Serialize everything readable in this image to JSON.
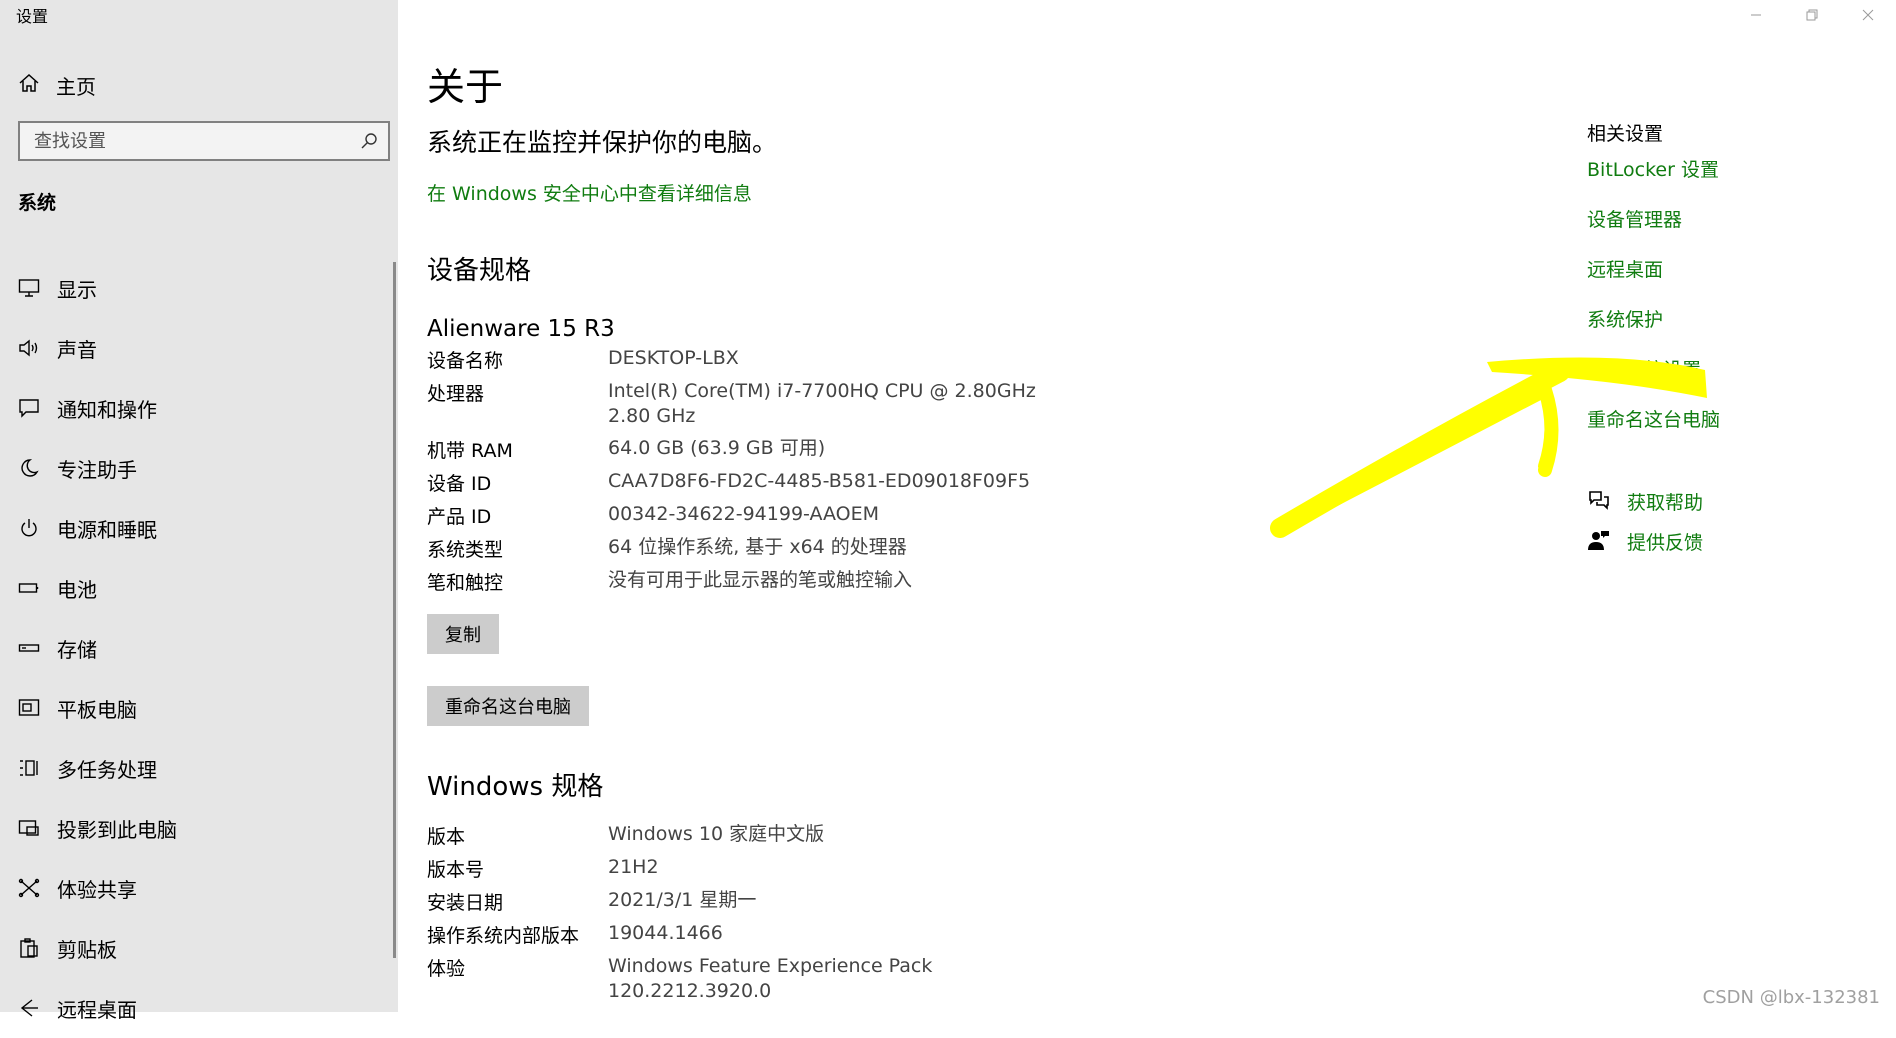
{
  "window": {
    "title": "设置",
    "controls": [
      "minimize-icon",
      "restore-icon",
      "close-icon"
    ]
  },
  "sidebar": {
    "home_label": "主页",
    "search_placeholder": "查找设置",
    "section_title": "系统",
    "items": [
      {
        "label": "显示",
        "icon": "display-icon"
      },
      {
        "label": "声音",
        "icon": "speaker-icon"
      },
      {
        "label": "通知和操作",
        "icon": "notification-icon"
      },
      {
        "label": "专注助手",
        "icon": "moon-icon"
      },
      {
        "label": "电源和睡眠",
        "icon": "power-icon"
      },
      {
        "label": "电池",
        "icon": "battery-icon"
      },
      {
        "label": "存储",
        "icon": "storage-icon"
      },
      {
        "label": "平板电脑",
        "icon": "tablet-icon"
      },
      {
        "label": "多任务处理",
        "icon": "multitask-icon"
      },
      {
        "label": "投影到此电脑",
        "icon": "project-icon"
      },
      {
        "label": "体验共享",
        "icon": "share-icon"
      },
      {
        "label": "剪贴板",
        "icon": "clipboard-icon"
      },
      {
        "label": "远程桌面",
        "icon": "remote-desktop-icon"
      }
    ]
  },
  "main": {
    "title": "关于",
    "protection_text": "系统正在监控并保护你的电脑。",
    "security_link": "在 Windows 安全中心中查看详细信息",
    "device_specs": {
      "heading": "设备规格",
      "device_model": "Alienware 15 R3",
      "rows": [
        {
          "key": "设备名称",
          "value": "DESKTOP-LBX"
        },
        {
          "key": "处理器",
          "value": "Intel(R) Core(TM) i7-7700HQ CPU @ 2.80GHz",
          "value2": "2.80 GHz"
        },
        {
          "key": "机带 RAM",
          "value": "64.0 GB (63.9 GB 可用)"
        },
        {
          "key": "设备 ID",
          "value": "CAA7D8F6-FD2C-4485-B581-ED09018F09F5"
        },
        {
          "key": "产品 ID",
          "value": "00342-34622-94199-AAOEM"
        },
        {
          "key": "系统类型",
          "value": "64 位操作系统, 基于 x64 的处理器"
        },
        {
          "key": "笔和触控",
          "value": "没有可用于此显示器的笔或触控输入"
        }
      ],
      "copy_button": "复制",
      "rename_button": "重命名这台电脑"
    },
    "windows_specs": {
      "heading": "Windows 规格",
      "rows": [
        {
          "key": "版本",
          "value": "Windows 10 家庭中文版"
        },
        {
          "key": "版本号",
          "value": "21H2"
        },
        {
          "key": "安装日期",
          "value": "2021/3/1 星期一"
        },
        {
          "key": "操作系统内部版本",
          "value": "19044.1466"
        },
        {
          "key": "体验",
          "value": "Windows Feature Experience Pack",
          "value2": "120.2212.3920.0"
        }
      ]
    }
  },
  "related": {
    "title": "相关设置",
    "links": [
      "BitLocker 设置",
      "设备管理器",
      "远程桌面",
      "系统保护",
      "高级系统设置",
      "重命名这台电脑"
    ],
    "help": [
      {
        "label": "获取帮助",
        "icon": "help-chat-icon"
      },
      {
        "label": "提供反馈",
        "icon": "feedback-icon"
      }
    ]
  },
  "annotation": {
    "color": "#ffff00",
    "shape": "arrow"
  },
  "watermark": "CSDN @lbx-132381",
  "colors": {
    "sidebar_bg": "#e6e6e6",
    "link_green": "#107c10",
    "button_bg": "#cccccc",
    "highlight": "#ffff00"
  }
}
